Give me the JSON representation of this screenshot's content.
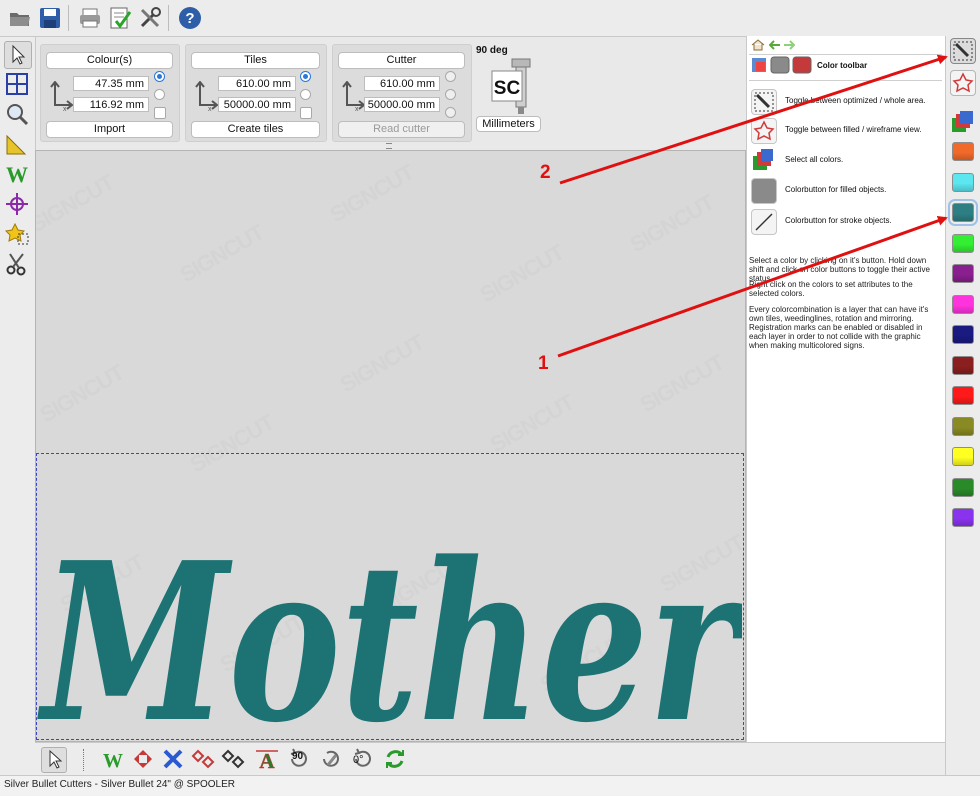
{
  "colours_panel": {
    "title": "Colour(s)",
    "value1": "47.35 mm",
    "value2": "116.92 mm",
    "action": "Import"
  },
  "tiles_panel": {
    "title": "Tiles",
    "value1": "610.00 mm",
    "value2": "50000.00 mm",
    "action": "Create tiles"
  },
  "cutter_panel": {
    "title": "Cutter",
    "value1": "610.00 mm",
    "value2": "50000.00 mm",
    "action": "Read cutter"
  },
  "rotation": {
    "label": "90 deg",
    "logo_text": "SC",
    "units": "Millimeters"
  },
  "canvas": {
    "text": "Mother",
    "watermark": "SIGNCUT",
    "text_color": "#1d7374"
  },
  "right_panel": {
    "title": "Color toolbar",
    "items": [
      {
        "label": "Toggle between optimized / whole area."
      },
      {
        "label": "Toggle between filled / wireframe view."
      },
      {
        "label": "Select all colors."
      },
      {
        "label": "Colorbutton for filled objects."
      },
      {
        "label": "Colorbutton for stroke objects."
      }
    ],
    "help": [
      "Select a color by clicking on it's button. Hold down shift and click on color buttons to toggle their active status.",
      "Right click on the colors to set attributes to the selected colors.",
      "Every colorcombination is a layer that can have it's own tiles, weedinglines, rotation and mirroring. Registration marks can be enabled or disabled in each layer in order to not collide with the graphic when making multicolored signs."
    ]
  },
  "color_bar": {
    "swatches": [
      "#f26a2a",
      "#5be6f0",
      "#2e7f84",
      "#33ee33",
      "#8a1f8f",
      "#ff33dd",
      "#1a1a80",
      "#8b1f1f",
      "#ff1a1a",
      "#8a8a24",
      "#ffff22",
      "#2a8a2a",
      "#8a33ee"
    ]
  },
  "bottom_toolbar": {
    "rotate_label": "90",
    "angle_label": "0°"
  },
  "annotations": {
    "one": "1",
    "two": "2"
  },
  "status_bar": {
    "text": "Silver Bullet Cutters - Silver Bullet 24\" @ SPOOLER"
  }
}
